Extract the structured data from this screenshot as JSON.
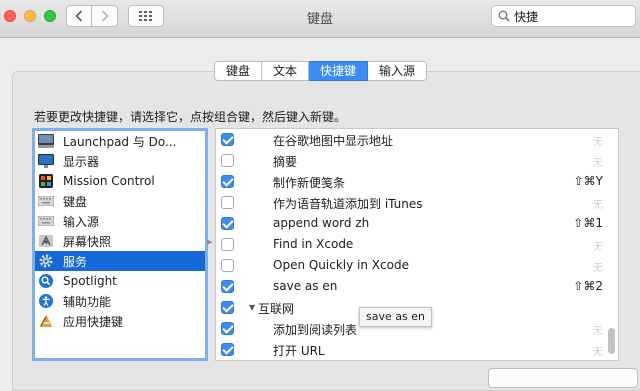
{
  "window": {
    "title": "键盘",
    "back_icon": "chevron-left-icon",
    "forward_icon": "chevron-right-icon",
    "grid_icon": "grid-icon"
  },
  "search": {
    "value": "快捷",
    "icon": "search-icon"
  },
  "tabs": [
    {
      "label": "键盘"
    },
    {
      "label": "文本"
    },
    {
      "label": "快捷键",
      "selected": true
    },
    {
      "label": "输入源"
    }
  ],
  "instruction": "若要更改快捷键，请选择它，点按组合键，然后键入新键。",
  "categories": [
    {
      "label": "Launchpad 与 Do...",
      "icon": "launchpad-icon"
    },
    {
      "label": "显示器",
      "icon": "display-icon"
    },
    {
      "label": "Mission Control",
      "icon": "mission-control-icon"
    },
    {
      "label": "键盘",
      "icon": "keyboard-icon"
    },
    {
      "label": "输入源",
      "icon": "keyboard-icon"
    },
    {
      "label": "屏幕快照",
      "icon": "screenshot-icon"
    },
    {
      "label": "服务",
      "icon": "gear-icon",
      "selected": true
    },
    {
      "label": "Spotlight",
      "icon": "spotlight-icon"
    },
    {
      "label": "辅助功能",
      "icon": "accessibility-icon"
    },
    {
      "label": "应用快捷键",
      "icon": "app-shortcuts-icon"
    }
  ],
  "shortcuts": [
    {
      "label": "在谷歌地图中显示地址",
      "checked": true,
      "shortcut": "无"
    },
    {
      "label": "摘要",
      "checked": false,
      "shortcut": "无"
    },
    {
      "label": "制作新便笺条",
      "checked": true,
      "shortcut": "⇧⌘Y"
    },
    {
      "label": "作为语音轨道添加到 iTunes",
      "checked": false,
      "shortcut": "无"
    },
    {
      "label": "append word zh",
      "checked": true,
      "shortcut": "⇧⌘1"
    },
    {
      "label": "Find in Xcode",
      "checked": false,
      "shortcut": "无"
    },
    {
      "label": "Open Quickly in Xcode",
      "checked": false,
      "shortcut": "无"
    },
    {
      "label": "save as en",
      "checked": true,
      "shortcut": "⇧⌘2"
    },
    {
      "label": "互联网",
      "checked": true,
      "group": true
    },
    {
      "label": "添加到阅读列表",
      "checked": true,
      "shortcut": "无"
    },
    {
      "label": "打开 URL",
      "checked": true,
      "shortcut": "无"
    }
  ],
  "tooltip": "save as en",
  "colors": {
    "accent": "#3a8cf2",
    "selection": "#1768d8",
    "traffic_close": "#fc605b",
    "traffic_minimize": "#fdbc40",
    "traffic_maximize": "#34c84a"
  }
}
